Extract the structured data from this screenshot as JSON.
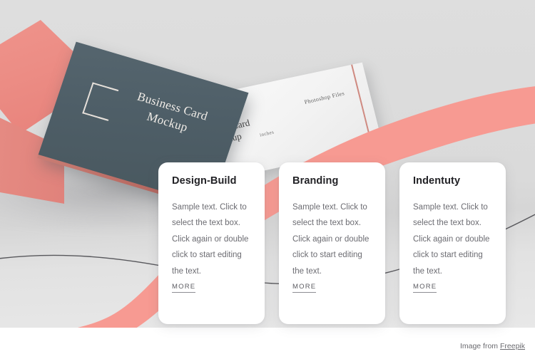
{
  "background": {
    "base_color": "#dbdbdb",
    "bottom_plate_color": "#ffffff",
    "wave_color": "#f79a92",
    "line_color": "#58585c"
  },
  "mockup": {
    "box_color": "#ec8d85",
    "dark_card": {
      "color": "#51616a",
      "logo": "bracket-logo",
      "line1": "Business Card",
      "line2": "Mockup"
    },
    "white_card": {
      "color": "#f5f5f5",
      "line1": "Business Card",
      "line2": "Mockup",
      "label_units": "inches",
      "label_files": "Photoshop Files"
    }
  },
  "cards": [
    {
      "title": "Design-Build",
      "body": "Sample text. Click to select the text box. Click again or double click to start editing the text.",
      "more_label": "MORE"
    },
    {
      "title": "Branding",
      "body": "Sample text. Click to select the text box. Click again or double click to start editing the text.",
      "more_label": "MORE"
    },
    {
      "title": "Indentuty",
      "body": "Sample text. Click to select the text box. Click again or double click to start editing the text.",
      "more_label": "MORE"
    }
  ],
  "footer": {
    "prefix": "Image from ",
    "link_label": "Freepik"
  }
}
